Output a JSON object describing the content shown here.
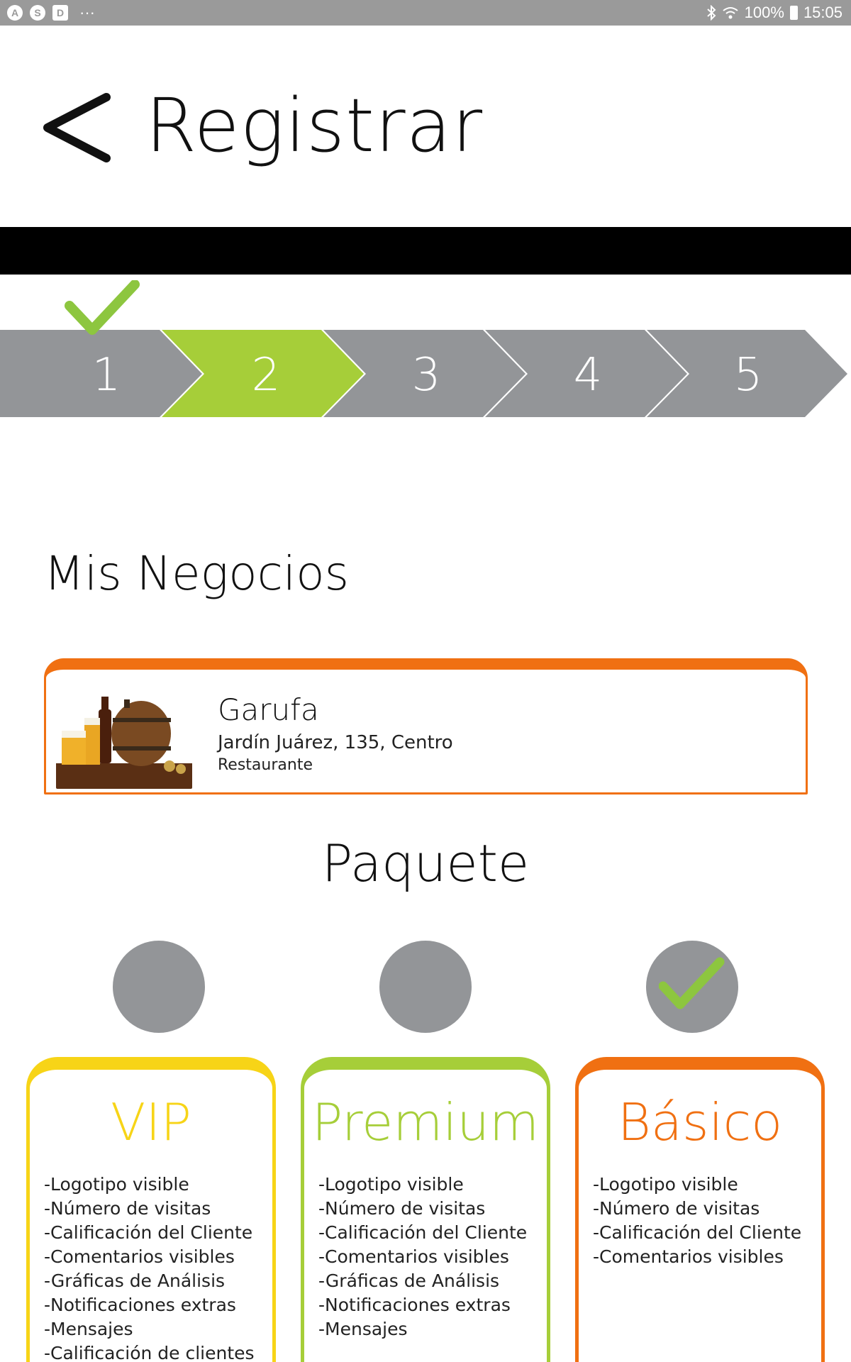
{
  "status_bar": {
    "app_icons": [
      "A",
      "S",
      "D"
    ],
    "more": "···",
    "battery": "100%",
    "time": "15:05"
  },
  "header": {
    "title": "Registrar"
  },
  "stepper": {
    "steps": [
      "1",
      "2",
      "3",
      "4",
      "5"
    ],
    "active_step": 2,
    "completed_steps": [
      1
    ]
  },
  "businesses": {
    "title": "Mis Negocios",
    "items": [
      {
        "name": "Garufa",
        "address": "Jardín Juárez, 135, Centro",
        "category": "Restaurante"
      }
    ]
  },
  "packages": {
    "title": "Paquete",
    "selected": "Básico",
    "items": [
      {
        "name": "VIP",
        "color": "#f7d417",
        "features": [
          "-Logotipo visible",
          "-Número de visitas",
          "-Calificación del Cliente",
          "-Comentarios visibles",
          "-Gráficas de Análisis",
          "-Notificaciones extras",
          "-Mensajes",
          "-Calificación de clientes"
        ]
      },
      {
        "name": "Premium",
        "color": "#a6ce39",
        "features": [
          "-Logotipo visible",
          "-Número de visitas",
          "-Calificación del Cliente",
          "-Comentarios visibles",
          "-Gráficas de Análisis",
          "-Notificaciones extras",
          "-Mensajes"
        ]
      },
      {
        "name": "Básico",
        "color": "#f07012",
        "features": [
          "-Logotipo visible",
          "-Número de visitas",
          "-Calificación del Cliente",
          "-Comentarios visibles"
        ]
      }
    ]
  },
  "colors": {
    "step_gray": "#939598",
    "step_active": "#a6ce39",
    "check_green": "#8dc63f",
    "business_border": "#f07012",
    "radio_gray": "#939598"
  }
}
